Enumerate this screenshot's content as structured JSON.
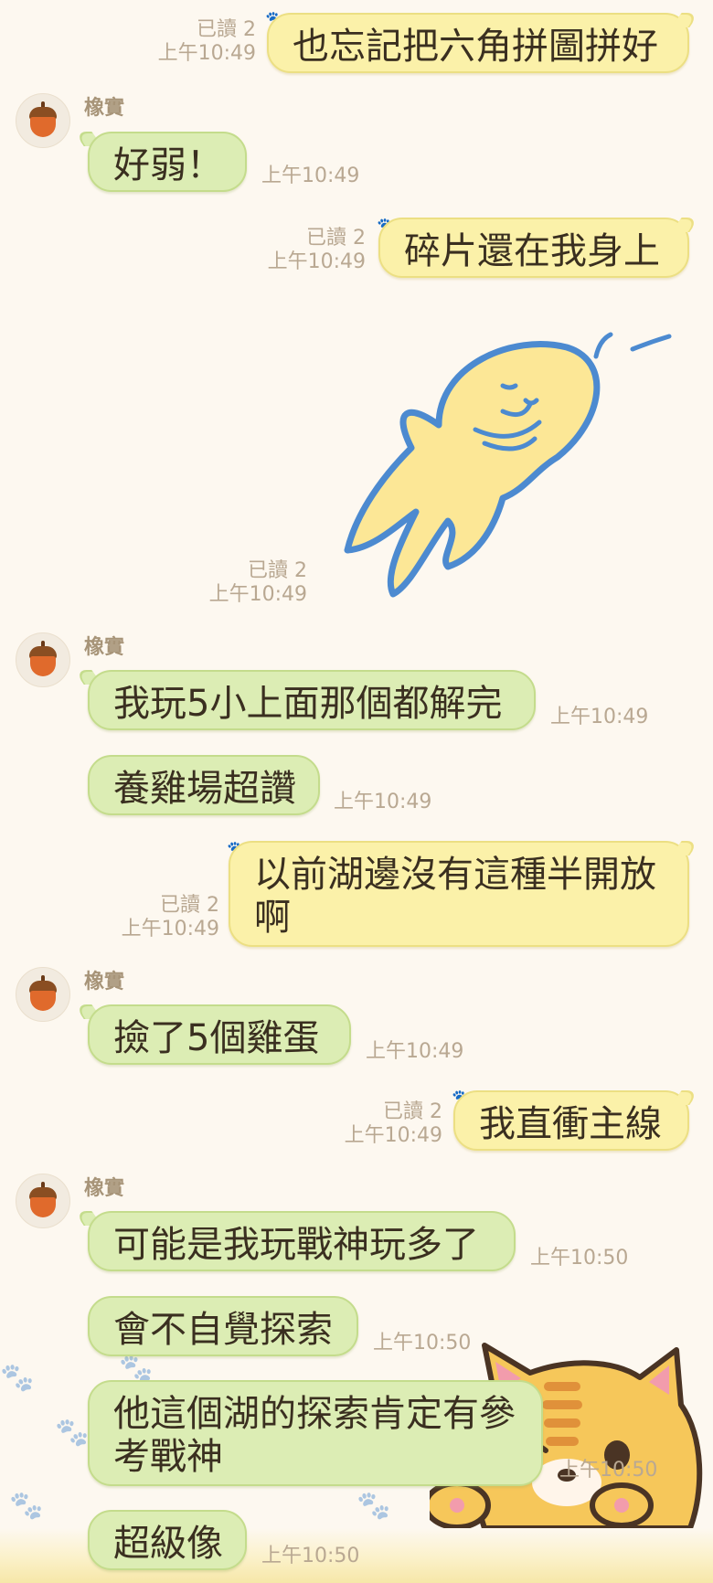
{
  "sender_name": "橡實",
  "read_label": "已讀 2",
  "messages": [
    {
      "text": "也忘記把六角拼圖拼好",
      "time": "上午10:49"
    },
    {
      "text": "好弱！",
      "time": "上午10:49"
    },
    {
      "text": "碎片還在我身上",
      "time": "上午10:49"
    },
    {
      "sticker": "yellow-blob-character",
      "time": "上午10:49"
    },
    {
      "text": "我玩5小上面那個都解完",
      "time": "上午10:49"
    },
    {
      "text": "養雞場超讚",
      "time": "上午10:49"
    },
    {
      "text": "以前湖邊沒有這種半開放啊",
      "line1": "以前湖邊沒有這種半開放",
      "line2": "啊",
      "time": "上午10:49"
    },
    {
      "text": "撿了5個雞蛋",
      "time": "上午10:49"
    },
    {
      "text": "我直衝主線",
      "time": "上午10:49"
    },
    {
      "text": "可能是我玩戰神玩多了",
      "time": "上午10:50"
    },
    {
      "text": "會不自覺探索",
      "time": "上午10:50"
    },
    {
      "text": "他這個湖的探索肯定有參考戰神",
      "line1": "他這個湖的探索肯定有參",
      "line2": "考戰神",
      "time": "上午10:50"
    },
    {
      "text": "超級像",
      "time": "上午10:50"
    }
  ],
  "colors": {
    "background": "#fdf8f0",
    "incoming_bubble": "#dcedb4",
    "outgoing_bubble": "#fbf1a9",
    "meta_text": "#b9a892"
  }
}
